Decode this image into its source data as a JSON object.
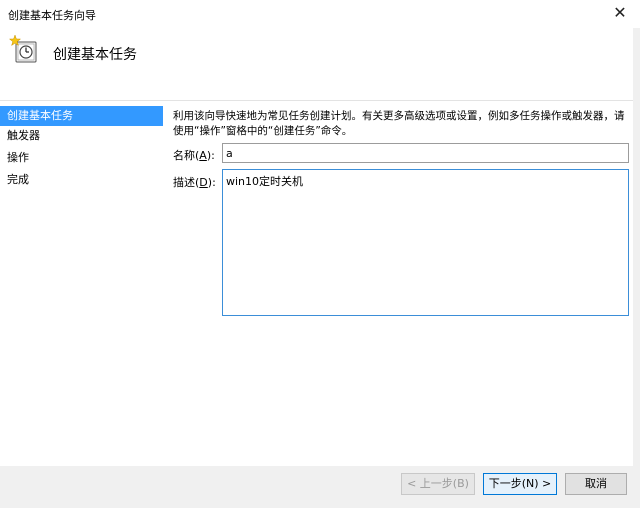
{
  "window": {
    "title": "创建基本任务向导",
    "close_glyph": "✕"
  },
  "header": {
    "heading": "创建基本任务",
    "icon": "task-scheduler-clock-icon"
  },
  "nav": {
    "items": [
      {
        "label": "创建基本任务",
        "selected": true
      },
      {
        "label": "触发器",
        "selected": false
      },
      {
        "label": "操作",
        "selected": false
      },
      {
        "label": "完成",
        "selected": false
      }
    ]
  },
  "form": {
    "intro": "利用该向导快速地为常见任务创建计划。有关更多高级选项或设置，例如多任务操作或触发器，请使用“操作”窗格中的“创建任务”命令。",
    "name_label": "名称(",
    "name_key": "A",
    "name_label_end": "):",
    "name_value": "a",
    "desc_label": "描述(",
    "desc_key": "D",
    "desc_label_end": "):",
    "desc_value": "win10定时关机"
  },
  "buttons": {
    "back": "< 上一步(B)",
    "next": "下一步(N) >",
    "cancel": "取消"
  },
  "colors": {
    "selection": "#3399ff",
    "focus_border": "#3b8ed8",
    "footer_bg": "#f0f0f0"
  }
}
